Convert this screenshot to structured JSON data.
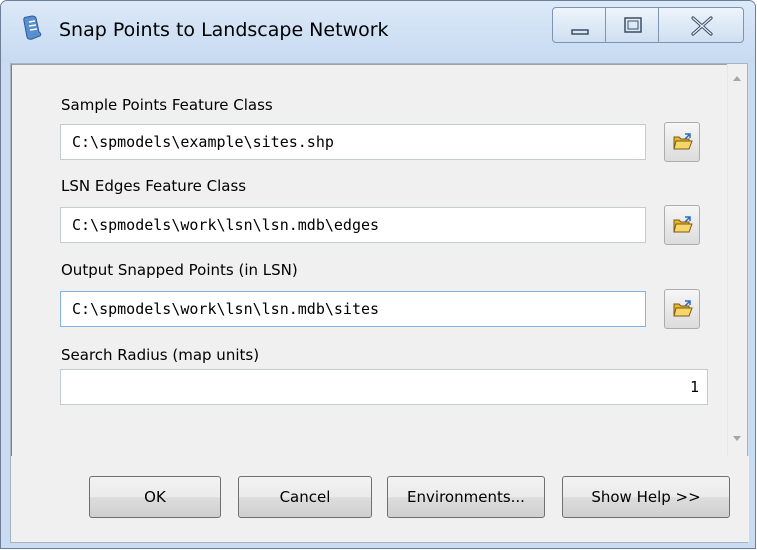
{
  "window": {
    "title": "Snap Points to Landscape Network"
  },
  "icons": {
    "app": "script-scroll-icon",
    "minimize": "minimize-icon",
    "maximize": "maximize-icon",
    "close": "close-icon",
    "browse": "open-folder-icon"
  },
  "form": {
    "sample_points": {
      "label": "Sample Points Feature Class",
      "value": "C:\\spmodels\\example\\sites.shp"
    },
    "lsn_edges": {
      "label": "LSN Edges Feature Class",
      "value": "C:\\spmodels\\work\\lsn\\lsn.mdb\\edges"
    },
    "output_points": {
      "label": "Output Snapped Points (in LSN)",
      "value": "C:\\spmodels\\work\\lsn\\lsn.mdb\\sites"
    },
    "search_radius": {
      "label": "Search Radius (map units)",
      "value": "1"
    }
  },
  "buttons": {
    "ok": "OK",
    "cancel": "Cancel",
    "environments": "Environments...",
    "show_help": "Show Help >>"
  },
  "colors": {
    "titlebar": "#c9dcf2",
    "focus_border": "#7eb4ea",
    "folder_yellow": "#f2c94c"
  }
}
